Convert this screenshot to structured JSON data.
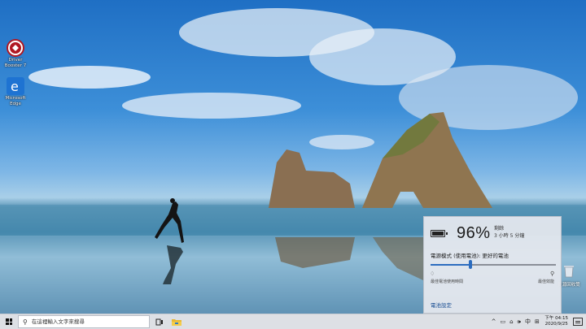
{
  "desktop": {
    "icons": [
      {
        "label": "Driver Booster 7",
        "icon": "driver-booster-icon",
        "color": "#d8202c"
      },
      {
        "label": "Microsoft Edge",
        "icon": "edge-icon",
        "color": "#1e73d2"
      }
    ],
    "recycle_bin": {
      "label": "資源回收筒",
      "icon": "recycle-bin-icon"
    }
  },
  "battery_flyout": {
    "percent": "96%",
    "remaining_label": "剩餘",
    "remaining_time": "3 小時 5 分鐘",
    "mode_label": "電源模式 (使用電池): 更好的電池",
    "slider_value": 0.32,
    "slider_left_label": "最佳電池使用時間",
    "slider_right_label": "最佳效能",
    "settings_link": "電池設定",
    "accent": "#2c6cbf"
  },
  "taskbar": {
    "search_placeholder": "在這裡輸入文字來搜尋",
    "tray": {
      "chevron": "^",
      "ime": "中",
      "time": "下午 04:15",
      "date": "2020/9/25"
    }
  }
}
